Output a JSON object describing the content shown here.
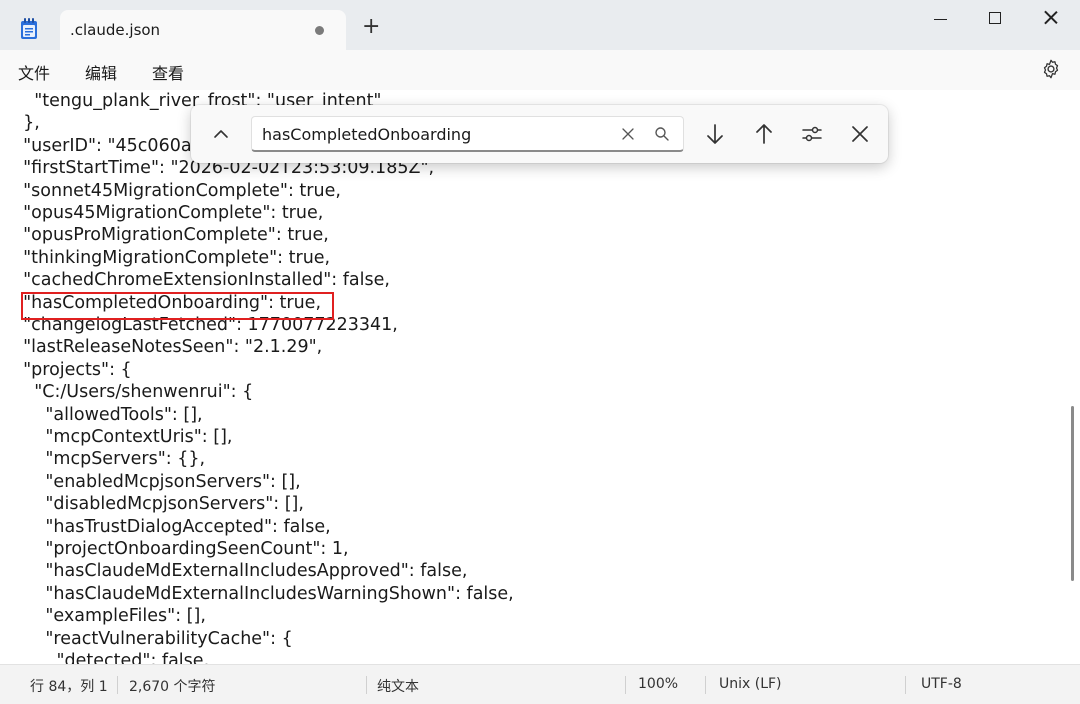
{
  "window": {
    "tab_title": ".claude.json",
    "new_tab_label": "+"
  },
  "menu": {
    "items": [
      "文件",
      "编辑",
      "查看"
    ]
  },
  "find": {
    "query": "hasCompletedOnboarding"
  },
  "editor": {
    "lines": [
      "    \"tengu_plank_river_frost\": \"user_intent\"",
      "  },",
      "  \"userID\": \"45c060a",
      "  \"firstStartTime\": \"2026-02-02T23:53:09.185Z\",",
      "  \"sonnet45MigrationComplete\": true,",
      "  \"opus45MigrationComplete\": true,",
      "  \"opusProMigrationComplete\": true,",
      "  \"thinkingMigrationComplete\": true,",
      "  \"cachedChromeExtensionInstalled\": false,",
      "  \"hasCompletedOnboarding\": true,",
      "  \"changelogLastFetched\": 1770077223341,",
      "  \"lastReleaseNotesSeen\": \"2.1.29\",",
      "  \"projects\": {",
      "    \"C:/Users/shenwenrui\": {",
      "      \"allowedTools\": [],",
      "      \"mcpContextUris\": [],",
      "      \"mcpServers\": {},",
      "      \"enabledMcpjsonServers\": [],",
      "      \"disabledMcpjsonServers\": [],",
      "      \"hasTrustDialogAccepted\": false,",
      "      \"projectOnboardingSeenCount\": 1,",
      "      \"hasClaudeMdExternalIncludesApproved\": false,",
      "      \"hasClaudeMdExternalIncludesWarningShown\": false,",
      "      \"exampleFiles\": [],",
      "      \"reactVulnerabilityCache\": {",
      "        \"detected\": false,"
    ]
  },
  "status": {
    "position": "行 84，列 1",
    "char_count": "2,670 个字符",
    "format": "纯文本",
    "zoom": "100%",
    "line_ending": "Unix (LF)",
    "encoding": "UTF-8"
  },
  "colors": {
    "highlight": "#e02020"
  }
}
